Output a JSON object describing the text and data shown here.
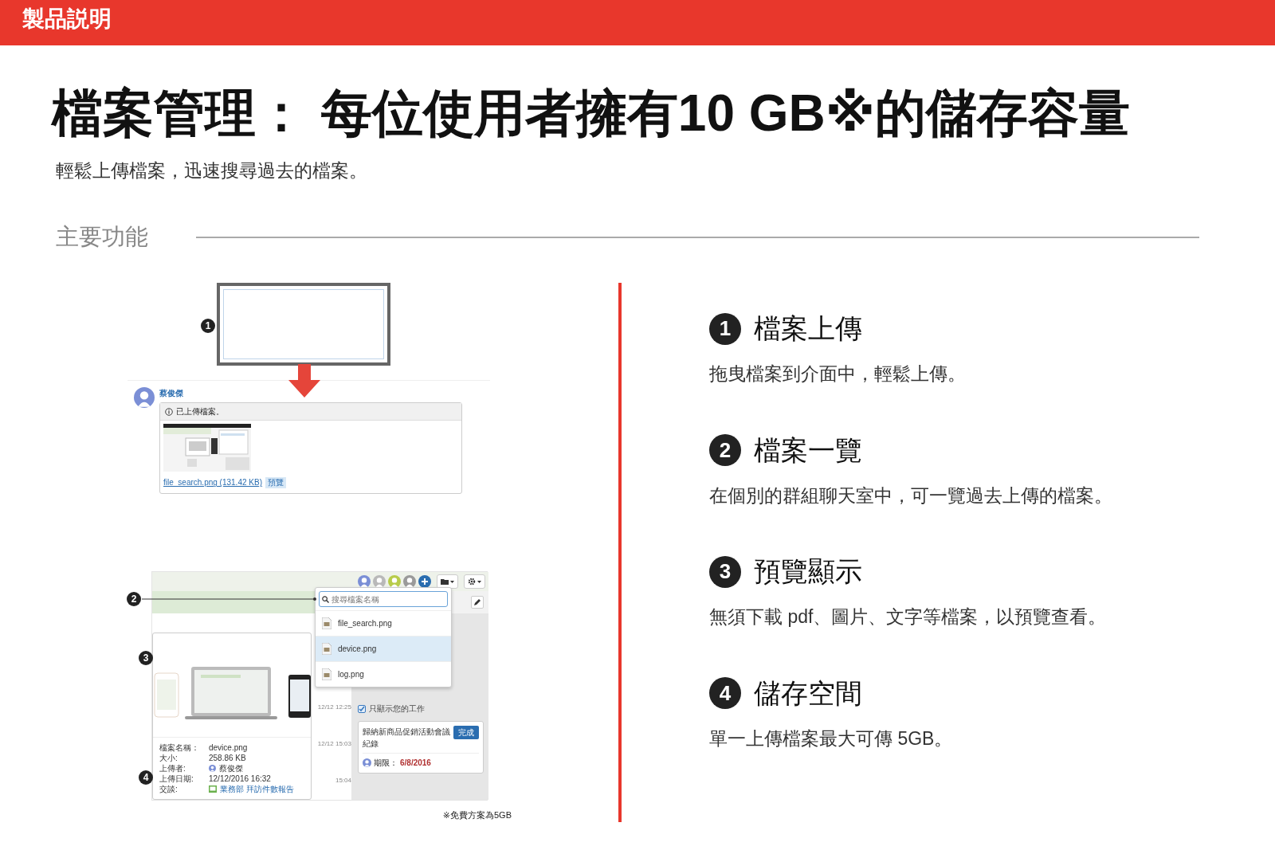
{
  "header": {
    "title": "製品説明"
  },
  "headline": "檔案管理： 每位使用者擁有10 GB※的儲存容量",
  "subtitle": "輕鬆上傳檔案，迅速搜尋過去的檔案。",
  "section_title": "主要功能",
  "upload_demo": {
    "marker": "1",
    "user_name": "蔡俊傑",
    "notice": "已上傳檔案。",
    "file_link": "file_search.png (131.42 KB)",
    "preview_button": "預覽"
  },
  "search_demo": {
    "markers": [
      "2",
      "3",
      "4"
    ],
    "search_placeholder": "搜尋檔案名稱",
    "results": [
      {
        "name": "file_search.png",
        "selected": false
      },
      {
        "name": "device.png",
        "selected": true
      },
      {
        "name": "log.png",
        "selected": false
      }
    ],
    "timestamps": [
      "12/12 12:25",
      "12/12 15:03",
      "15:04"
    ],
    "details": [
      {
        "label": "檔案名稱：",
        "value": "device.png",
        "kind": "text"
      },
      {
        "label": "大小:",
        "value": "258.86 KB",
        "kind": "text"
      },
      {
        "label": "上傳者:",
        "value": "蔡俊傑",
        "kind": "user"
      },
      {
        "label": "上傳日期:",
        "value": "12/12/2016 16:32",
        "kind": "text"
      },
      {
        "label": "交談:",
        "value": "業務部 拜訪件數報告",
        "kind": "link"
      }
    ],
    "filter": {
      "label": "只顯示您的工作",
      "checked": true
    },
    "task": {
      "title": "歸納新商品促銷活動會議紀錄",
      "button": "完成",
      "due_label": "期限：",
      "due_date": "6/8/2016"
    }
  },
  "footnote": "※免費方案為5GB",
  "features": [
    {
      "number": "1",
      "title": "檔案上傳",
      "description": "拖曳檔案到介面中，輕鬆上傳。"
    },
    {
      "number": "2",
      "title": "檔案一覽",
      "description": "在個別的群組聊天室中，可一覽過去上傳的檔案。"
    },
    {
      "number": "3",
      "title": "預覽顯示",
      "description": "無須下載 pdf、圖片、文字等檔案，以預覽查看。"
    },
    {
      "number": "4",
      "title": "儲存空間",
      "description": "單一上傳檔案最大可傳 5GB。"
    }
  ]
}
